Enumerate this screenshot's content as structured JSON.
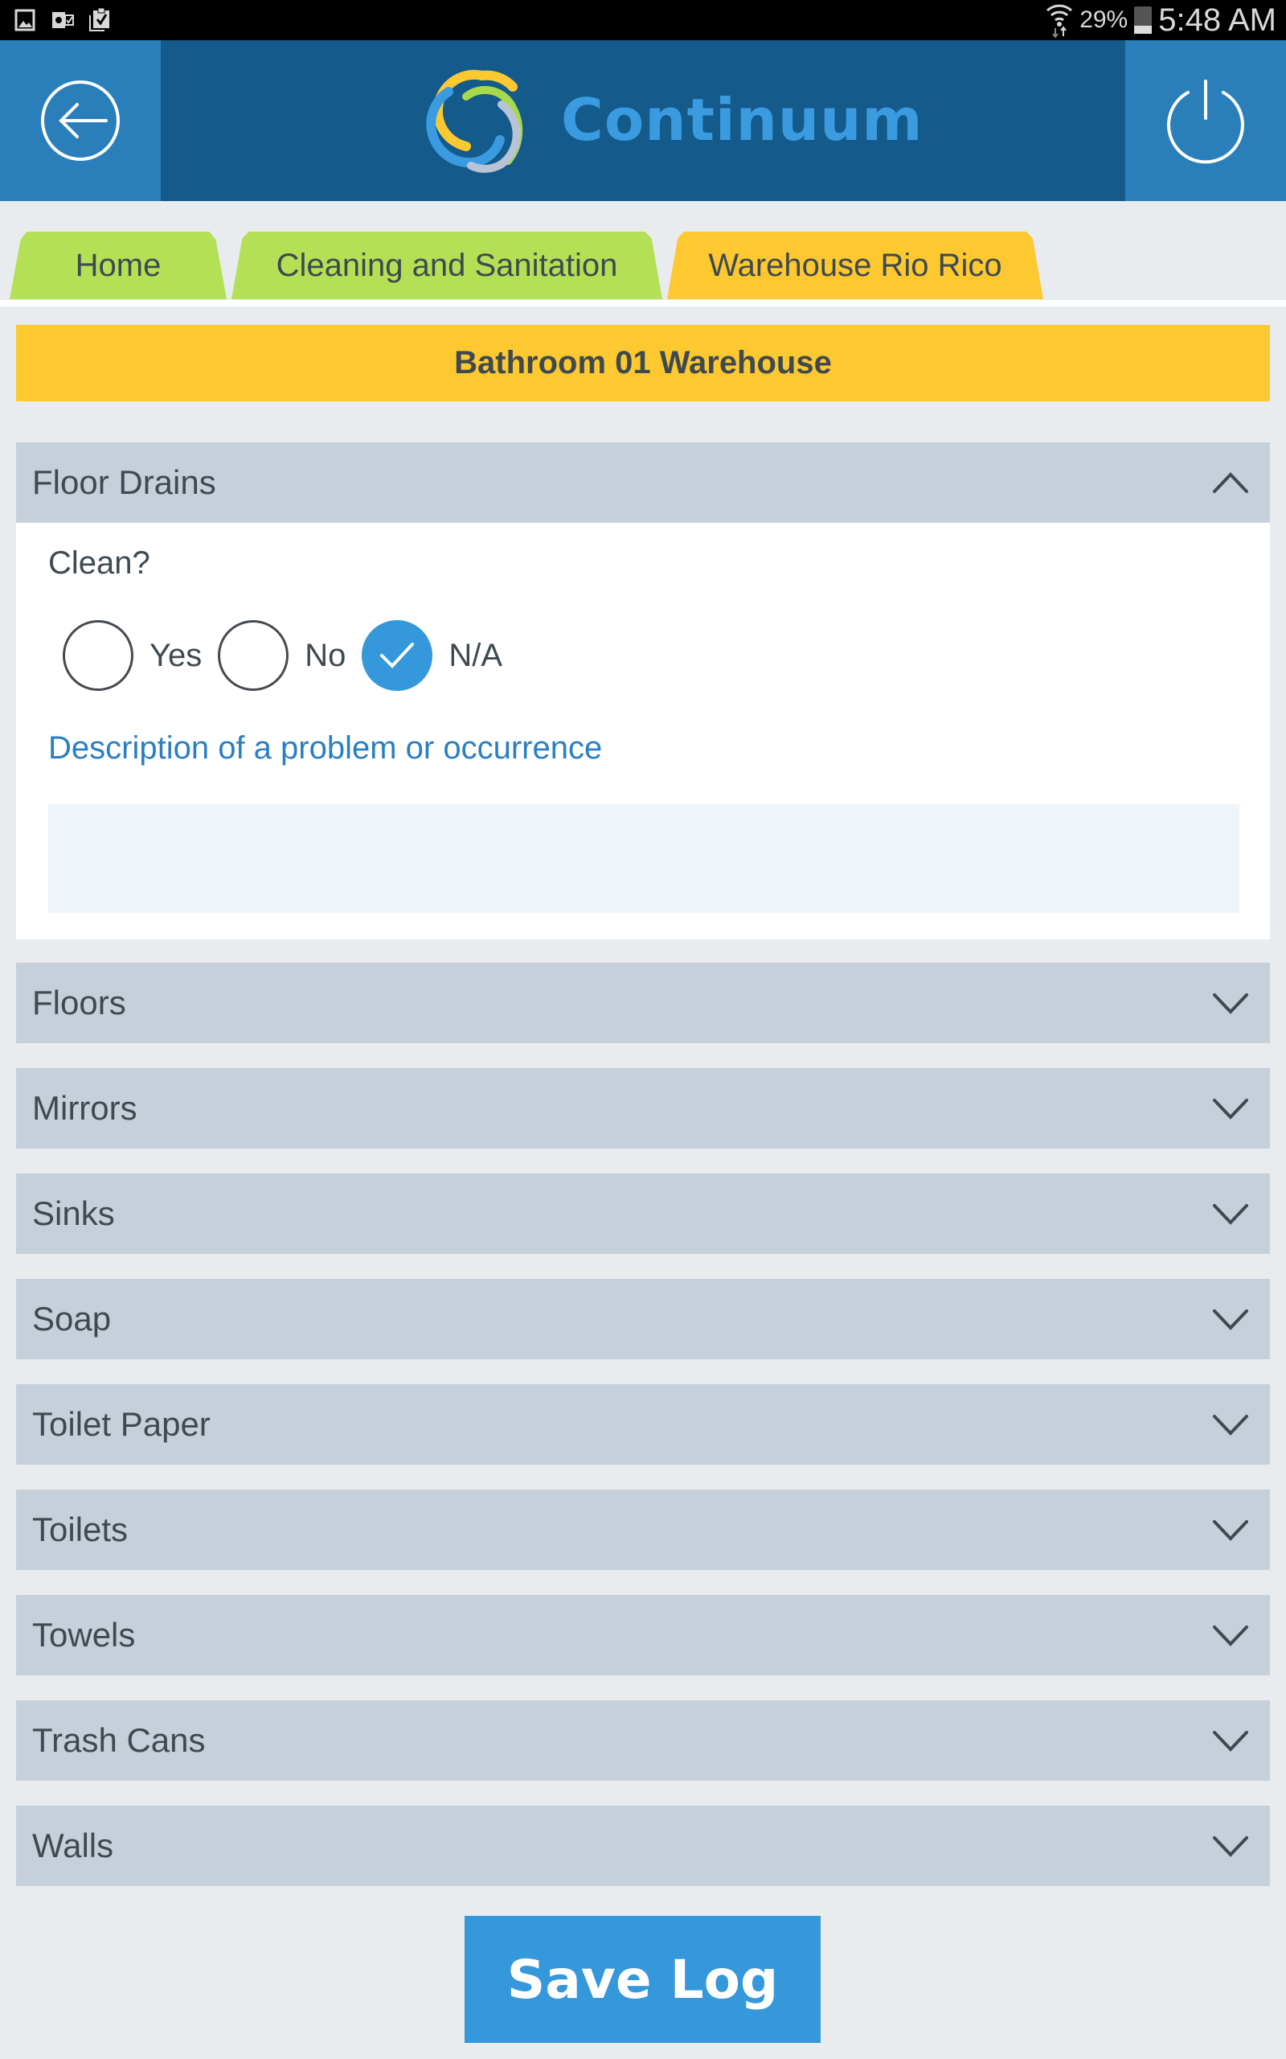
{
  "status_bar": {
    "left_icons": [
      "gallery-icon",
      "outlook-icon",
      "clipboard-check-icon"
    ],
    "wifi_icon": "wifi-icon",
    "battery_percent": "29%",
    "battery_level": 0.29,
    "time": "5:48 AM"
  },
  "header": {
    "back_icon": "back-arrow-circle-icon",
    "app_name": "Continuum",
    "logo_colors": [
      "#fdc830",
      "#a8d94a",
      "#3a9be0",
      "#b8c4d6"
    ],
    "power_icon": "power-icon",
    "colors": {
      "bar": "#145a8a",
      "button": "#2a7fba"
    }
  },
  "breadcrumb_tabs": [
    {
      "label": "Home",
      "color": "#b3e055"
    },
    {
      "label": "Cleaning and Sanitation",
      "color": "#b3e055"
    },
    {
      "label": "Warehouse Rio Rico",
      "color": "#fdc830"
    }
  ],
  "page_title": "Bathroom 01 Warehouse",
  "sections": [
    {
      "label": "Floor Drains",
      "expanded": true,
      "question": "Clean?",
      "options": [
        {
          "label": "Yes",
          "checked": false
        },
        {
          "label": "No",
          "checked": false
        },
        {
          "label": "N/A",
          "checked": true
        }
      ],
      "description_label": "Description of a problem or occurrence",
      "description_value": ""
    },
    {
      "label": "Floors",
      "expanded": false
    },
    {
      "label": "Mirrors",
      "expanded": false
    },
    {
      "label": "Sinks",
      "expanded": false
    },
    {
      "label": "Soap",
      "expanded": false
    },
    {
      "label": "Toilet Paper",
      "expanded": false
    },
    {
      "label": "Toilets",
      "expanded": false
    },
    {
      "label": "Towels",
      "expanded": false
    },
    {
      "label": "Trash Cans",
      "expanded": false
    },
    {
      "label": "Walls",
      "expanded": false
    }
  ],
  "save_button": {
    "label": "Save Log",
    "color": "#3498db"
  }
}
